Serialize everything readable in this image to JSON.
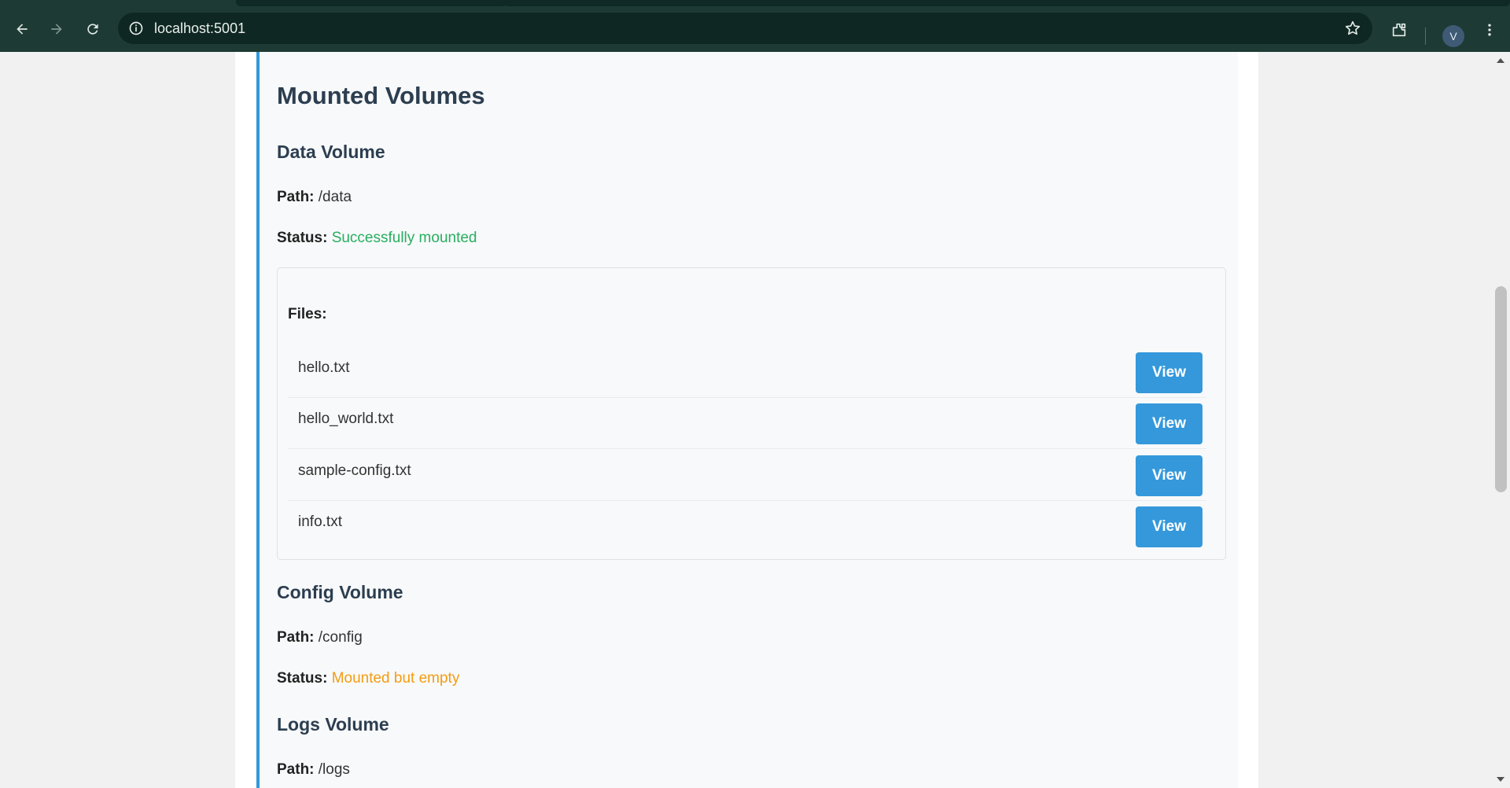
{
  "browser": {
    "url": "localhost:5001",
    "profile_initial": "V",
    "icons": {
      "back": "arrow-left-icon",
      "forward": "arrow-right-icon",
      "reload": "reload-icon",
      "site_info": "info-icon",
      "bookmark": "star-icon",
      "extensions": "puzzle-icon",
      "menu": "kebab-menu-icon"
    }
  },
  "page": {
    "section_title": "Mounted Volumes",
    "path_label": "Path:",
    "status_label": "Status:",
    "volumes": [
      {
        "name": "Data Volume",
        "path": "/data",
        "status": "Successfully mounted",
        "status_color": "#27ae60",
        "files_label": "Files:",
        "files": [
          {
            "name": "hello.txt",
            "action": "View"
          },
          {
            "name": "hello_world.txt",
            "action": "View"
          },
          {
            "name": "sample-config.txt",
            "action": "View"
          },
          {
            "name": "info.txt",
            "action": "View"
          }
        ]
      },
      {
        "name": "Config Volume",
        "path": "/config",
        "status": "Mounted but empty",
        "status_color": "#f39c12"
      },
      {
        "name": "Logs Volume",
        "path": "/logs"
      }
    ]
  },
  "colors": {
    "accent": "#3498db",
    "heading": "#2c3e50",
    "success": "#27ae60",
    "warning": "#f39c12",
    "chrome": "#1e3a34"
  }
}
